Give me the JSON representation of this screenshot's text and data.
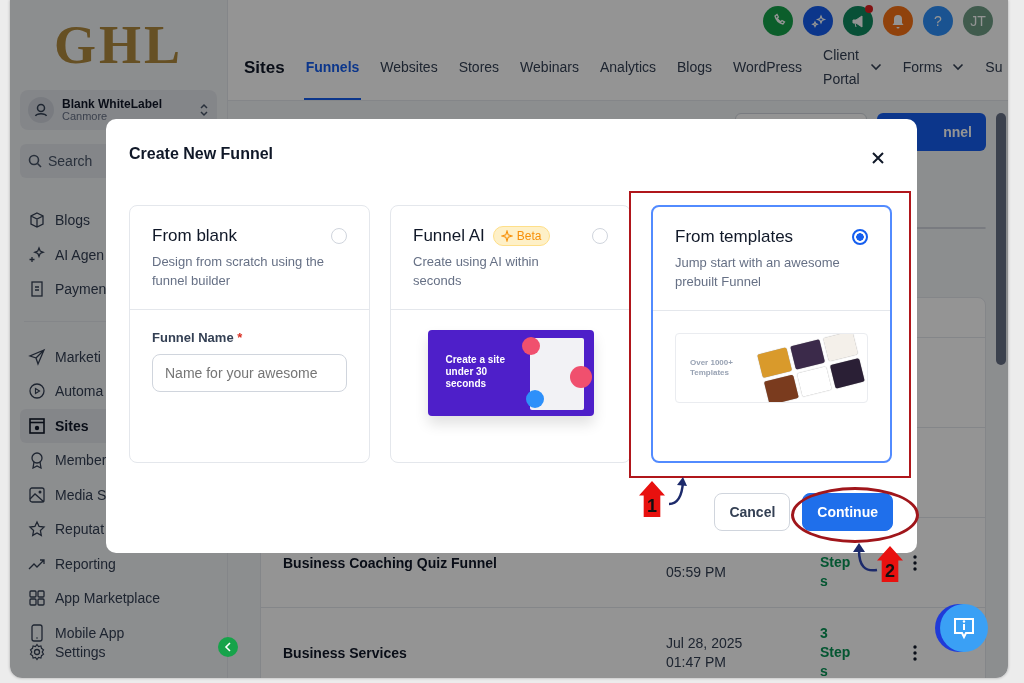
{
  "sidebar": {
    "logo": "GHL",
    "account": {
      "name": "Blank WhiteLabel",
      "location": "Canmore"
    },
    "search": {
      "placeholder": "Search"
    },
    "items": [
      {
        "label": "Blogs",
        "selected": false
      },
      {
        "label": "AI Agen",
        "selected": false
      },
      {
        "label": "Paymen",
        "selected": false
      },
      {
        "label": "Marketi",
        "selected": false
      },
      {
        "label": "Automa",
        "selected": false
      },
      {
        "label": "Sites",
        "selected": true
      },
      {
        "label": "Member",
        "selected": false
      },
      {
        "label": "Media S",
        "selected": false
      },
      {
        "label": "Reputat",
        "selected": false
      },
      {
        "label": "Reporting",
        "selected": false
      },
      {
        "label": "App Marketplace",
        "selected": false
      },
      {
        "label": "Mobile App",
        "selected": false
      }
    ],
    "footer": {
      "label": "Settings"
    }
  },
  "header": {
    "help": "?",
    "avatar": "JT",
    "title": "Sites",
    "tabs": [
      {
        "label": "Funnels",
        "selected": true,
        "dropdown": false
      },
      {
        "label": "Websites",
        "selected": false,
        "dropdown": false
      },
      {
        "label": "Stores",
        "selected": false,
        "dropdown": false
      },
      {
        "label": "Webinars",
        "selected": false,
        "dropdown": false
      },
      {
        "label": "Analytics",
        "selected": false,
        "dropdown": false
      },
      {
        "label": "Blogs",
        "selected": false,
        "dropdown": false
      },
      {
        "label": "WordPress",
        "selected": false,
        "dropdown": false
      },
      {
        "label": "Client Portal",
        "selected": false,
        "dropdown": true
      },
      {
        "label": "Forms",
        "selected": false,
        "dropdown": true
      },
      {
        "label": "Su",
        "selected": false,
        "dropdown": false
      }
    ]
  },
  "toolbar": {
    "create_button": "nnel"
  },
  "rows": [
    {
      "kind": "covered"
    },
    {
      "kind": "covered"
    },
    {
      "kind": "funnel",
      "name": "Business Coaching Quiz Funnel",
      "time": "05:59 PM",
      "steps": "Steps"
    },
    {
      "kind": "funnel",
      "name": "Business Services",
      "date": "Jul 28, 2025",
      "time": "01:47 PM",
      "steps": "3 Steps"
    }
  ],
  "modal": {
    "title": "Create New Funnel",
    "options": [
      {
        "kind": "blank",
        "title": "From blank",
        "description": "Design from scratch using the funnel builder",
        "selected": false,
        "field_label": "Funnel Name",
        "required_mark": "*",
        "placeholder": "Name for your awesome"
      },
      {
        "kind": "ai",
        "title": "Funnel AI",
        "badge": "Beta",
        "description": "Create using AI within seconds",
        "selected": false,
        "preview_text": "Create a site under 30 seconds"
      },
      {
        "kind": "templates",
        "title": "From templates",
        "description": "Jump start with an awesome prebuilt Funnel",
        "selected": true,
        "preview_text": "Over 1000+ Templates"
      }
    ],
    "cancel": "Cancel",
    "continue": "Continue"
  },
  "annotations": [
    {
      "kind": "box",
      "step": "1"
    },
    {
      "kind": "ellipse",
      "step": "2"
    }
  ]
}
